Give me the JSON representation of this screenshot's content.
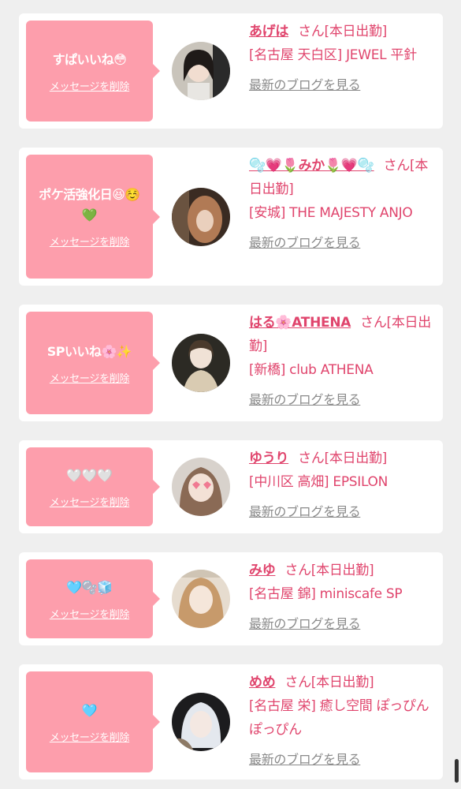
{
  "delete_label": "メッセージを削除",
  "blog_label": "最新のブログを見る",
  "honorific": "さん[本日出勤]",
  "colors": {
    "page_bg": "#efefef",
    "card_bg": "#ffffff",
    "message_bg": "#fd9eac",
    "accent": "#e0456d",
    "link_gray": "#8a8a8a"
  },
  "messages": [
    {
      "text": "すぱいいね😳",
      "name": "あげは",
      "shop": "[名古屋 天白区] JEWEL 平針"
    },
    {
      "text": "ポケ活強化日😆☺️💚",
      "name": "🫧💗🌷みか🌷💗🫧",
      "shop": "[安城] THE MAJESTY ANJO"
    },
    {
      "text": "SPいいね🌸✨",
      "name": "はる🌸ATHENA",
      "shop": "[新橋] club ATHENA"
    },
    {
      "text": "🤍🤍🤍",
      "name": "ゆうり",
      "shop": "[中川区 高畑] EPSILON"
    },
    {
      "text": "🩵🫧🧊",
      "name": "みゆ",
      "shop": "[名古屋 錦] miniscafe SP"
    },
    {
      "text": "🩵",
      "name": "めめ",
      "shop": "[名古屋 栄] 癒し空間 ぽっぴんぽっぴん"
    }
  ]
}
